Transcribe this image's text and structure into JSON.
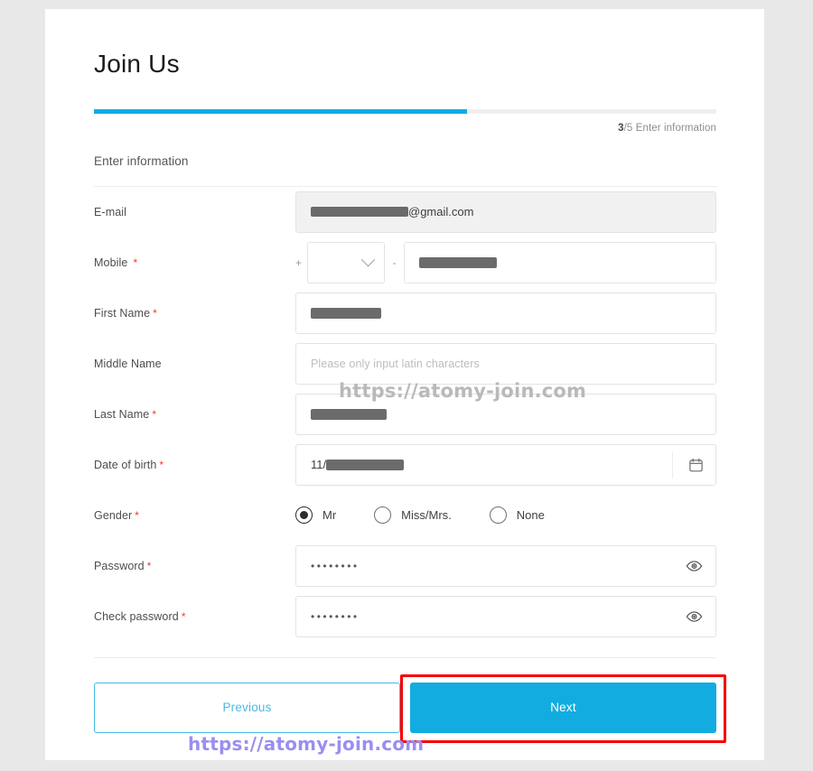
{
  "page": {
    "title": "Join Us",
    "section_title": "Enter information",
    "progress": {
      "current_step": "3",
      "step_separator": "/5",
      "step_label": " Enter information",
      "percent": 60,
      "fill_color": "#12ace0",
      "track_color": "#efefef"
    }
  },
  "form": {
    "fields": [
      {
        "key": "email",
        "label": "E-mail",
        "required": false,
        "type": "email",
        "disabled": true,
        "value_redacted": true,
        "value_suffix": "@gmail.com"
      },
      {
        "key": "mobile",
        "label": "Mobile",
        "required": true,
        "type": "phone",
        "prefix_symbol": "+",
        "separator_symbol": "-",
        "country_code_value": "",
        "number_redacted": true
      },
      {
        "key": "first_name",
        "label": "First Name",
        "required": true,
        "type": "text",
        "value_redacted": true
      },
      {
        "key": "middle_name",
        "label": "Middle Name",
        "required": false,
        "type": "text",
        "placeholder": "Please only input latin characters",
        "value": ""
      },
      {
        "key": "last_name",
        "label": "Last Name",
        "required": true,
        "type": "text",
        "value_redacted": true
      },
      {
        "key": "date_of_birth",
        "label": "Date of birth",
        "required": true,
        "type": "date",
        "value_prefix": "11/",
        "value_redacted": true,
        "icon": "calendar-icon"
      },
      {
        "key": "gender",
        "label": "Gender",
        "required": true,
        "type": "radio",
        "options": [
          {
            "label": "Mr",
            "selected": true
          },
          {
            "label": "Miss/Mrs.",
            "selected": false
          },
          {
            "label": "None",
            "selected": false
          }
        ]
      },
      {
        "key": "password",
        "label": "Password",
        "required": true,
        "type": "password",
        "masked_value": "••••••••",
        "icon": "eye-icon"
      },
      {
        "key": "check_password",
        "label": "Check password",
        "required": true,
        "type": "password",
        "masked_value": "••••••••",
        "icon": "eye-icon"
      }
    ],
    "required_marker": "*"
  },
  "footer": {
    "previous_label": "Previous",
    "next_label": "Next",
    "next_highlighted": true,
    "highlight_color": "#f50000",
    "accent_color": "#12ace0"
  },
  "watermarks": {
    "middle": "https://atomy-join.com",
    "bottom": "https://atomy-join.com"
  }
}
